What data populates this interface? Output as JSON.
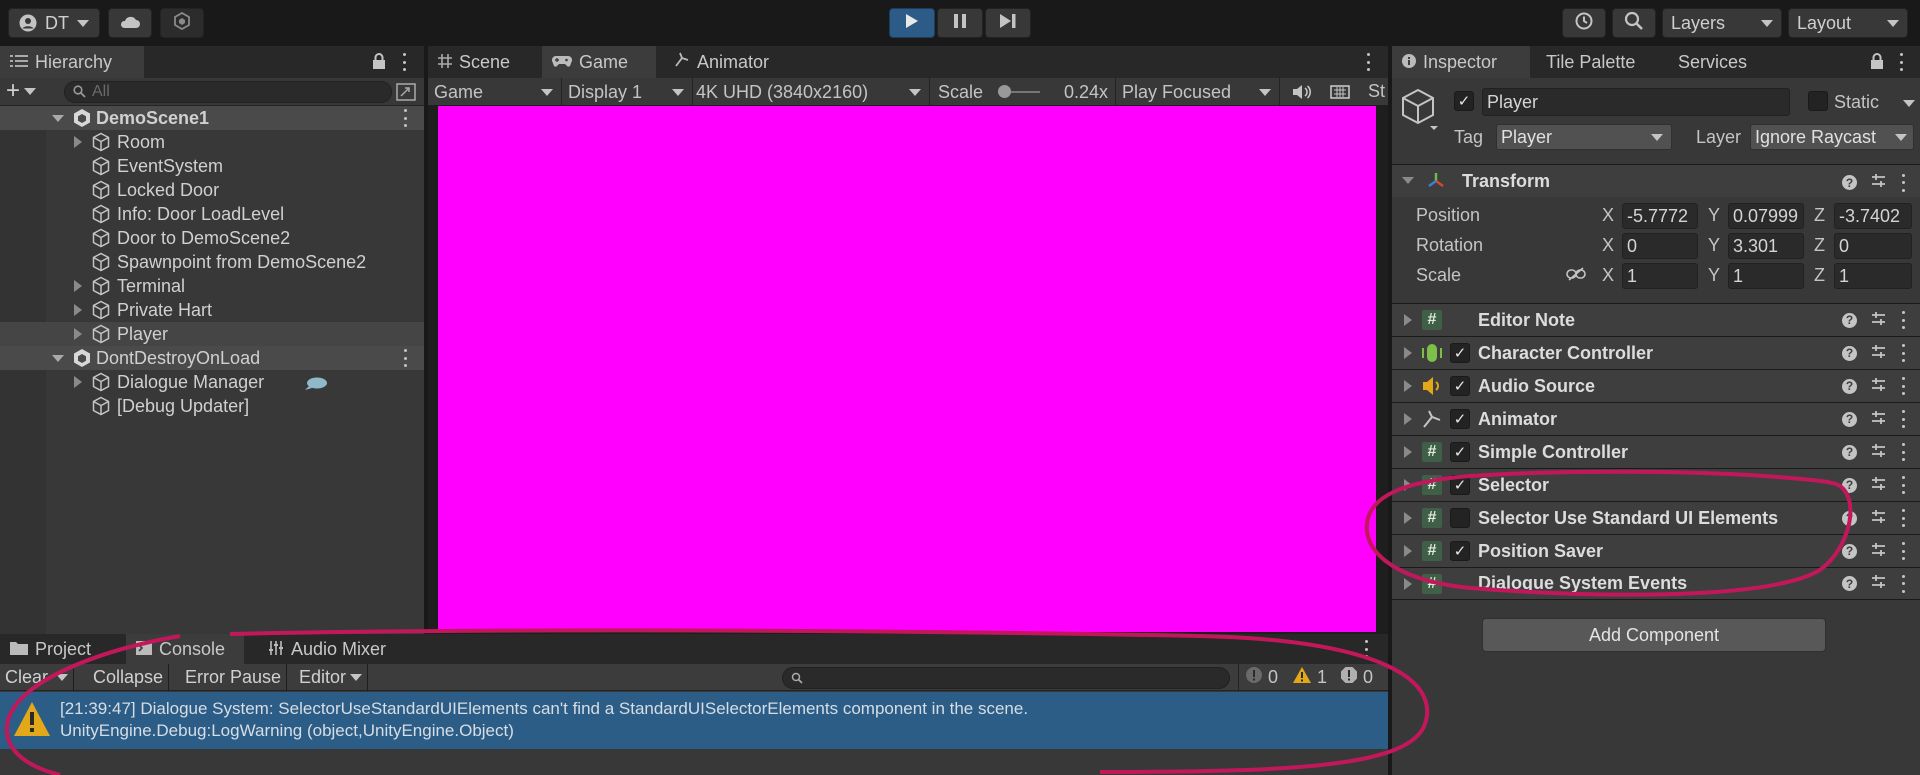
{
  "toolbar": {
    "account": "DT",
    "layers": "Layers",
    "layout": "Layout"
  },
  "hierarchy": {
    "tab": "Hierarchy",
    "search_placeholder": "All",
    "items": [
      {
        "label": "DemoScene1"
      },
      {
        "label": "Room"
      },
      {
        "label": "EventSystem"
      },
      {
        "label": "Locked Door"
      },
      {
        "label": "Info: Door LoadLevel"
      },
      {
        "label": "Door to DemoScene2"
      },
      {
        "label": "Spawnpoint from DemoScene2"
      },
      {
        "label": "Terminal"
      },
      {
        "label": "Private Hart"
      },
      {
        "label": "Player"
      },
      {
        "label": "DontDestroyOnLoad"
      },
      {
        "label": "Dialogue Manager"
      },
      {
        "label": "[Debug Updater]"
      }
    ]
  },
  "center": {
    "tabs": [
      "Scene",
      "Game",
      "Animator"
    ],
    "game_toolbar": {
      "view": "Game",
      "display": "Display 1",
      "resolution": "4K UHD (3840x2160)",
      "scale_label": "Scale",
      "scale_value": "0.24x",
      "play_mode": "Play Focused",
      "stats": "St"
    },
    "viewport_color": "#ff00ff"
  },
  "console": {
    "tabs": [
      "Project",
      "Console",
      "Audio Mixer"
    ],
    "buttons": {
      "clear": "Clear",
      "collapse": "Collapse",
      "error_pause": "Error Pause",
      "editor": "Editor"
    },
    "counts": {
      "info": "0",
      "warn": "1",
      "error": "0"
    },
    "log_line1": "[21:39:47] Dialogue System: SelectorUseStandardUIElements can't find a StandardUISelectorElements component in the scene.",
    "log_line2": "UnityEngine.Debug:LogWarning (object,UnityEngine.Object)"
  },
  "inspector": {
    "tabs": [
      "Inspector",
      "Tile Palette",
      "Services"
    ],
    "object_name": "Player",
    "static_label": "Static",
    "tag_label": "Tag",
    "tag_value": "Player",
    "layer_label": "Layer",
    "layer_value": "Ignore Raycast",
    "transform": {
      "title": "Transform",
      "position_label": "Position",
      "rotation_label": "Rotation",
      "scale_label": "Scale",
      "axis_x": "X",
      "axis_y": "Y",
      "axis_z": "Z",
      "position": [
        "-5.7772",
        "0.07999",
        "-3.7402"
      ],
      "rotation": [
        "0",
        "3.301",
        "0"
      ],
      "scale": [
        "1",
        "1",
        "1"
      ]
    },
    "components": [
      {
        "name": "Editor Note"
      },
      {
        "name": "Character Controller"
      },
      {
        "name": "Audio Source"
      },
      {
        "name": "Animator"
      },
      {
        "name": "Simple Controller"
      },
      {
        "name": "Selector"
      },
      {
        "name": "Selector Use Standard UI Elements"
      },
      {
        "name": "Position Saver"
      },
      {
        "name": "Dialogue System Events"
      }
    ],
    "add_component": "Add Component"
  },
  "colors": {
    "accent_play": "#2d5b88",
    "selection": "#2c5d87",
    "annotation": "#c2185b",
    "script_icon": "#3f5f46"
  }
}
